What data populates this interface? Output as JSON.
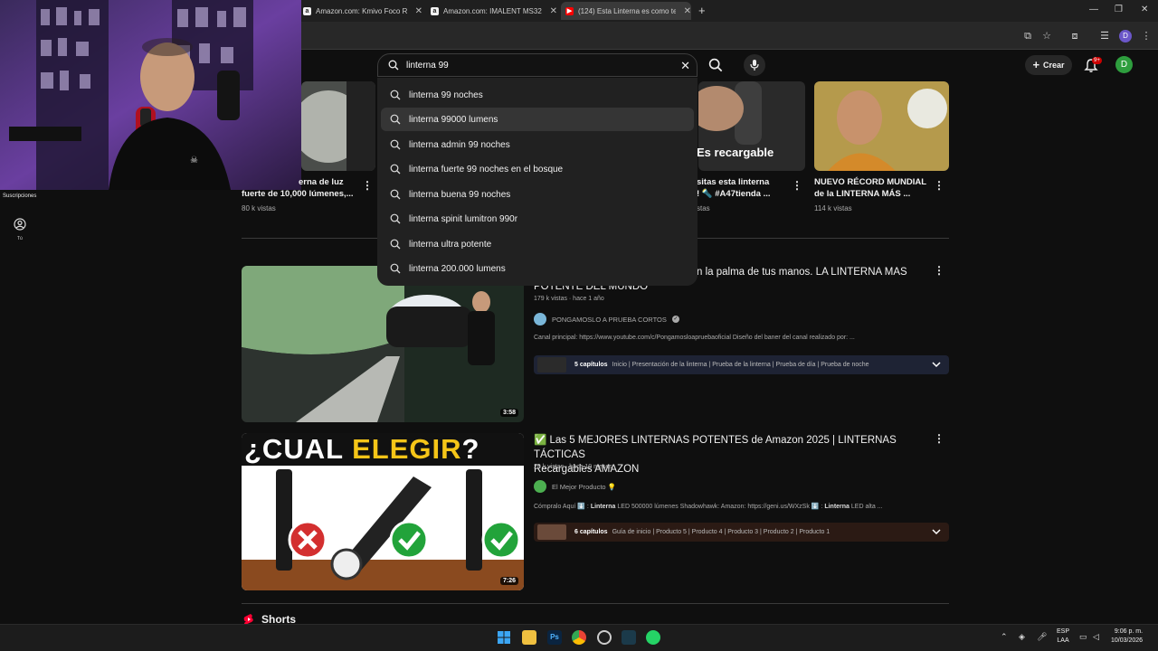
{
  "browser": {
    "tabs": [
      {
        "title": "Amazon.com: Kmivo Foco Rec",
        "favicon": "a"
      },
      {
        "title": "Amazon.com: IMALENT MS32",
        "favicon": "a"
      },
      {
        "title": "(124) Esta Linterna es como ten",
        "favicon": "yt"
      }
    ],
    "new_tab": "+",
    "profile_initial": "D"
  },
  "search": {
    "query": "linterna 99",
    "suggestions": [
      "linterna 99 noches",
      "linterna 99000 lumens",
      "linterna admin 99 noches",
      "linterna fuerte 99 noches en el bosque",
      "linterna buena 99 noches",
      "linterna spinit lumitron 990r",
      "linterna ultra potente",
      "linterna 200.000 lumens"
    ],
    "highlighted_index": 1
  },
  "header": {
    "create_label": "Crear",
    "notif_badge": "9+",
    "avatar_initial": "D"
  },
  "sidebar": {
    "subscriptions_label": "Suscripciones",
    "you_label": "Tú"
  },
  "top_row": [
    {
      "title_line1": "erna de luz",
      "title_line2": "fuerte de 10,000 lúmenes,...",
      "views": "80 k vistas"
    },
    {
      "overlay": "Es recargable",
      "title_line1": "sitas esta linterna",
      "title_line2": "! 🔦 #A47tienda ...",
      "views": "stas"
    },
    {
      "title_line1": "NUEVO RÉCORD MUNDIAL",
      "title_line2": "de la LINTERNA MÁS ...",
      "views": "114 k vistas"
    }
  ],
  "video1": {
    "title_line1": "n la palma de tus manos. LA LINTERNA MAS",
    "title_line2": "POTENTE DEL MUNDO",
    "meta": "179 k vistas · hace 1 año",
    "channel": "PONGAMOSLO A PRUEBA CORTOS",
    "description": "Canal principal: https://www.youtube.com/c/Pongamosloapruebaoficial Diseño del baner del canal realizado por: ...",
    "duration": "3:58",
    "chapters_count": "5 capítulos",
    "chapters_list": "Inicio | Presentación de la linterna | Prueba de la linterna | Prueba de día | Prueba de noche"
  },
  "video2": {
    "title_line1": "✅ Las 5 MEJORES LINTERNAS POTENTES de Amazon 2025 | LINTERNAS TÁCTICAS",
    "title_line2": "Recargables AMAZON",
    "meta": "28 k vistas · hace 10 meses",
    "channel": "El Mejor Producto 💡",
    "description_prefix": "Cómpralo Aquí ⬇️ : ",
    "description_bold": "Linterna",
    "description_rest": " LED 500000 lúmenes Shadowhawk: Amazon: https://geni.us/WXzSk ⬇️ : ",
    "description_bold2": "Linterna",
    "description_rest2": " LED alta ...",
    "duration": "7:26",
    "thumb_text_1": "¿CUAL ",
    "thumb_text_2": "ELEGIR",
    "thumb_text_3": "?",
    "chapters_count": "6 capítulos",
    "chapters_list": "Guía de inicio | Producto 5 | Producto 4 | Producto 3 | Producto 2 | Producto 1"
  },
  "shorts_label": "Shorts",
  "taskbar": {
    "lang_1": "ESP",
    "lang_2": "LAA",
    "time": "9:06 p. m.",
    "date": "10/03/2026"
  },
  "colors": {
    "accent_red": "#ff0000",
    "background": "#0f0f0f",
    "dropdown_bg": "#212121"
  }
}
